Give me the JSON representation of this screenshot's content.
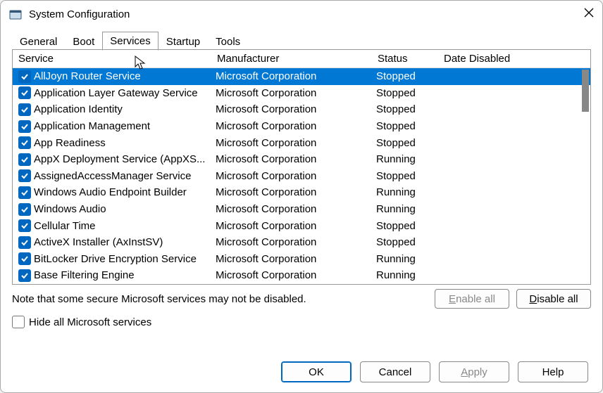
{
  "window": {
    "title": "System Configuration"
  },
  "tabs": {
    "items": [
      "General",
      "Boot",
      "Services",
      "Startup",
      "Tools"
    ],
    "active": 2
  },
  "columns": {
    "service": "Service",
    "manufacturer": "Manufacturer",
    "status": "Status",
    "date_disabled": "Date Disabled"
  },
  "services": [
    {
      "checked": true,
      "name": "AllJoyn Router Service",
      "mfr": "Microsoft Corporation",
      "status": "Stopped",
      "date": "",
      "selected": true
    },
    {
      "checked": true,
      "name": "Application Layer Gateway Service",
      "mfr": "Microsoft Corporation",
      "status": "Stopped",
      "date": ""
    },
    {
      "checked": true,
      "name": "Application Identity",
      "mfr": "Microsoft Corporation",
      "status": "Stopped",
      "date": ""
    },
    {
      "checked": true,
      "name": "Application Management",
      "mfr": "Microsoft Corporation",
      "status": "Stopped",
      "date": ""
    },
    {
      "checked": true,
      "name": "App Readiness",
      "mfr": "Microsoft Corporation",
      "status": "Stopped",
      "date": ""
    },
    {
      "checked": true,
      "name": "AppX Deployment Service (AppXS...",
      "mfr": "Microsoft Corporation",
      "status": "Running",
      "date": ""
    },
    {
      "checked": true,
      "name": "AssignedAccessManager Service",
      "mfr": "Microsoft Corporation",
      "status": "Stopped",
      "date": ""
    },
    {
      "checked": true,
      "name": "Windows Audio Endpoint Builder",
      "mfr": "Microsoft Corporation",
      "status": "Running",
      "date": ""
    },
    {
      "checked": true,
      "name": "Windows Audio",
      "mfr": "Microsoft Corporation",
      "status": "Running",
      "date": ""
    },
    {
      "checked": true,
      "name": "Cellular Time",
      "mfr": "Microsoft Corporation",
      "status": "Stopped",
      "date": ""
    },
    {
      "checked": true,
      "name": "ActiveX Installer (AxInstSV)",
      "mfr": "Microsoft Corporation",
      "status": "Stopped",
      "date": ""
    },
    {
      "checked": true,
      "name": "BitLocker Drive Encryption Service",
      "mfr": "Microsoft Corporation",
      "status": "Running",
      "date": ""
    },
    {
      "checked": true,
      "name": "Base Filtering Engine",
      "mfr": "Microsoft Corporation",
      "status": "Running",
      "date": ""
    }
  ],
  "note": "Note that some secure Microsoft services may not be disabled.",
  "buttons": {
    "enable_all": "Enable all",
    "disable_all": "Disable all",
    "hide_ms": "Hide all Microsoft services",
    "ok": "OK",
    "cancel": "Cancel",
    "apply": "Apply",
    "help": "Help"
  }
}
